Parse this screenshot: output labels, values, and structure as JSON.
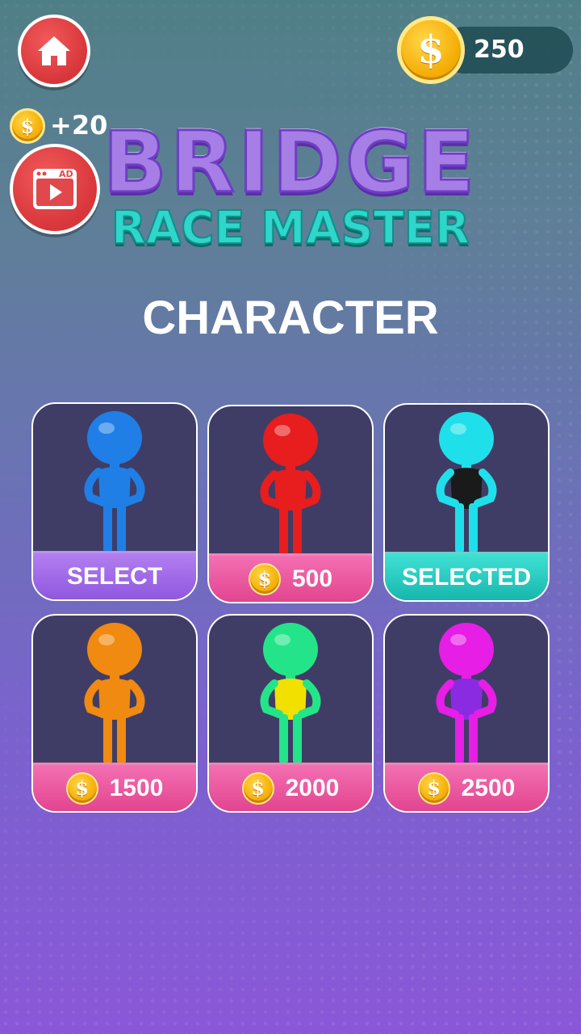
{
  "balance": "250",
  "ad_reward": "+20",
  "ad_label": "AD",
  "title_line1": "BRIDGE",
  "title_line2": "RACE MASTER",
  "heading": "CHARACTER",
  "coin_symbol": "$",
  "characters": [
    {
      "color": "#1f7fe6",
      "state": "select",
      "label": "SELECT"
    },
    {
      "color": "#e81d1d",
      "state": "price",
      "label": "500"
    },
    {
      "color": "#1fe0ea",
      "state": "selected",
      "label": "SELECTED",
      "vest": "#1a1a1a"
    },
    {
      "color": "#f08a10",
      "state": "price",
      "label": "1500"
    },
    {
      "color": "#24e48a",
      "state": "price",
      "label": "2000",
      "vest": "#f2e000"
    },
    {
      "color": "#e61ee6",
      "state": "price",
      "label": "2500",
      "vest": "#8a2be2"
    }
  ]
}
